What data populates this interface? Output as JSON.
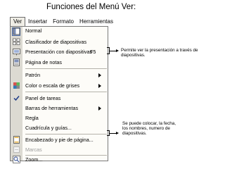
{
  "title": "Funciones del Menú Ver:",
  "menubar": [
    "Ver",
    "Insertar",
    "Formato",
    "Herramientas"
  ],
  "menu": {
    "items": [
      {
        "label": "Normal",
        "icon": "normal-view-icon",
        "selected": true
      },
      {
        "label": "Clasificador de diapositivas",
        "icon": "slide-sorter-icon"
      },
      {
        "label": "Presentación con diapositivas",
        "shortcut": "F5",
        "icon": "slideshow-icon"
      },
      {
        "label": "Página de notas",
        "icon": "notes-page-icon"
      },
      {
        "label": "Patrón",
        "submenu": true
      },
      {
        "label": "Color o escala de grises",
        "submenu": true,
        "icon": "color-grayscale-icon"
      },
      {
        "label": "Panel de tareas",
        "checked": true,
        "icon": "checkmark-icon"
      },
      {
        "label": "Barras de herramientas",
        "submenu": true
      },
      {
        "label": "Regla"
      },
      {
        "label": "Cuadrícula y guías..."
      },
      {
        "label": "Encabezado y pie de página...",
        "icon": "header-footer-icon"
      },
      {
        "label": "Marcas",
        "disabled": true,
        "icon": "markup-icon"
      },
      {
        "label": "Zoom...",
        "icon": "zoom-icon"
      }
    ]
  },
  "annotations": {
    "slideshow_note": "Permite ver la presentación a través de diapositivas.",
    "header_note": "Se puede colocar, la fecha, los nombres, numero de diapositivas."
  },
  "colors": {
    "accent": "#4a6aa5",
    "menu_bg": "#fdfcf8",
    "gutter": "#dcdad2"
  }
}
